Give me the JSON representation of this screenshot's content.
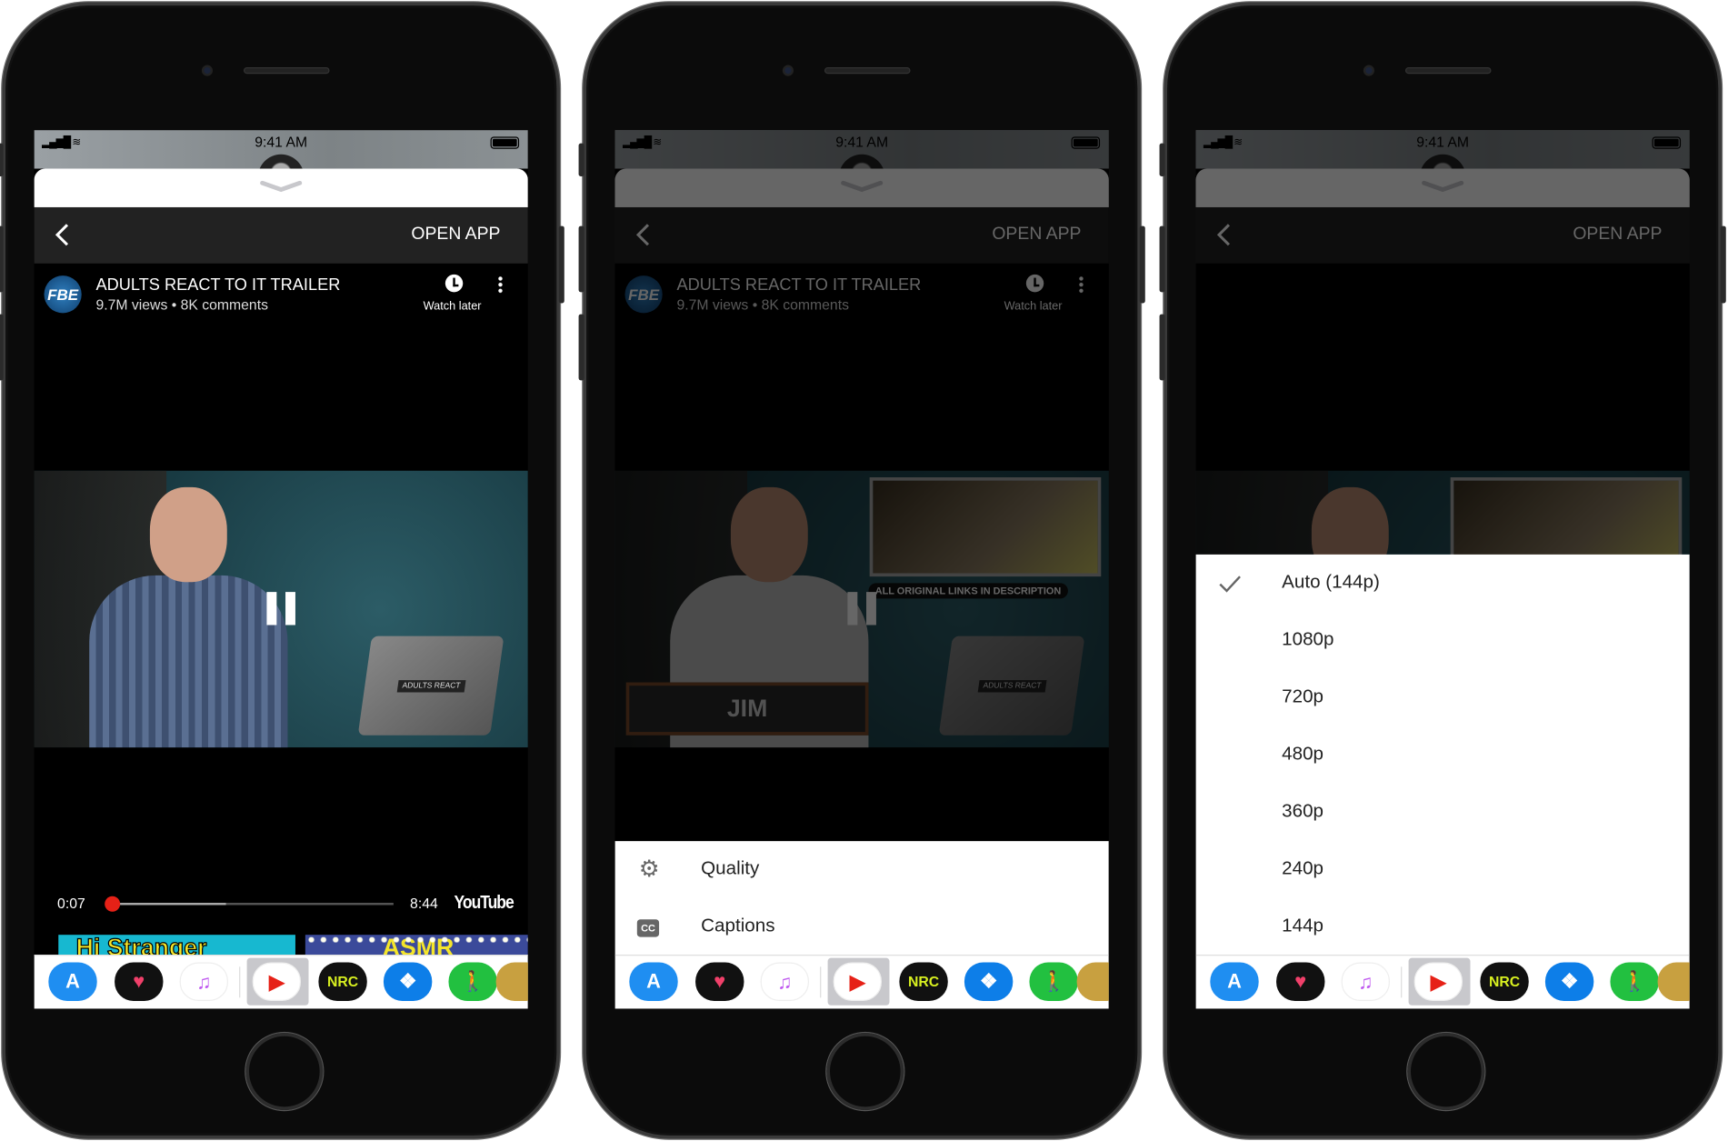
{
  "colors": {
    "accent": "#e62117",
    "nav_bg": "#222222",
    "dock_bg": "#ffffff"
  },
  "phones": [
    {
      "state": "playing",
      "status": {
        "time": "9:41 AM"
      },
      "nav": {
        "back_icon": "chevron-left-icon",
        "open_app": "OPEN APP"
      },
      "video": {
        "title": "ADULTS REACT TO IT TRAILER",
        "meta": "9.7M views • 8K comments",
        "channel_logo": "FBE",
        "watch_later": "Watch later"
      },
      "player": {
        "current": "0:07",
        "duration": "8:44",
        "played_fraction": 0.013,
        "buffered_fraction": 0.41,
        "brand": "YouTube"
      },
      "related": [
        {
          "title": "Hi Stranger"
        },
        {
          "title": "ASMR"
        }
      ]
    },
    {
      "state": "settings-menu",
      "status": {
        "time": "9:41 AM"
      },
      "nav": {
        "back_icon": "chevron-left-icon",
        "open_app": "OPEN APP"
      },
      "video": {
        "title": "ADULTS REACT TO IT TRAILER",
        "meta": "9.7M views • 8K comments",
        "channel_logo": "FBE",
        "watch_later": "Watch later",
        "overlay_caption": "ALL ORIGINAL LINKS IN DESCRIPTION",
        "nameplate": "JIM"
      },
      "menu": [
        {
          "icon": "gear-icon",
          "label": "Quality"
        },
        {
          "icon": "closed-captions-icon",
          "label": "Captions"
        }
      ]
    },
    {
      "state": "quality-menu",
      "status": {
        "time": "9:41 AM"
      },
      "nav": {
        "back_icon": "chevron-left-icon",
        "open_app": "OPEN APP"
      },
      "quality": {
        "selected": "Auto (144p)",
        "options": [
          "Auto (144p)",
          "1080p",
          "720p",
          "480p",
          "360p",
          "240p",
          "144p"
        ]
      }
    }
  ],
  "dock": [
    {
      "name": "app-store-icon",
      "bg": "#1f8ef1",
      "fg": "#fff",
      "glyph": "A"
    },
    {
      "name": "heart-app-icon",
      "bg": "#111",
      "fg": "#f0406a",
      "glyph": "♥"
    },
    {
      "name": "music-icon",
      "bg": "#fff",
      "fg": "#c05cf0",
      "glyph": "♫"
    },
    {
      "name": "youtube-icon",
      "bg": "#fff",
      "fg": "#e62117",
      "glyph": "▶"
    },
    {
      "name": "nike-run-club-icon",
      "bg": "#111",
      "fg": "#d8f020",
      "glyph": "NRC"
    },
    {
      "name": "dropbox-icon",
      "bg": "#0d7ee8",
      "fg": "#fff",
      "glyph": "❖"
    },
    {
      "name": "fitness-walk-icon",
      "bg": "#22c040",
      "fg": "#fff",
      "glyph": "🚶"
    },
    {
      "name": "gold-app-icon",
      "bg": "#c8a040",
      "fg": "#fff",
      "glyph": ""
    }
  ]
}
